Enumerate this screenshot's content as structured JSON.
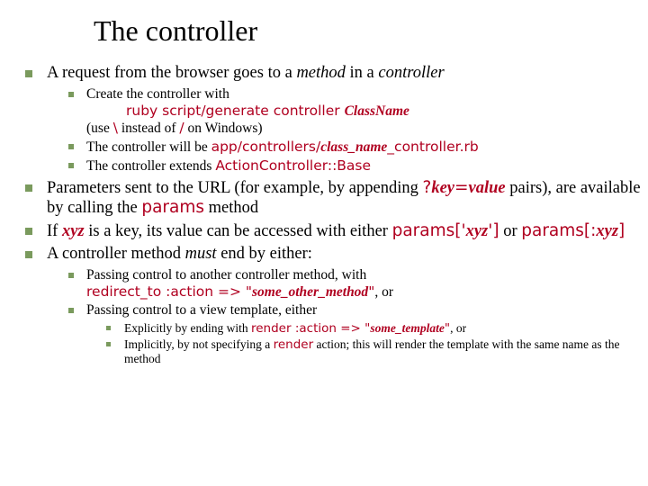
{
  "title": "The controller",
  "b1": {
    "t0a": "A request from the browser goes to a ",
    "t0b": "method",
    "t0c": " in a ",
    "t0d": "controller"
  },
  "b1s": {
    "a0": "Create the controller with",
    "a1": "ruby script/generate controller ",
    "a2": "ClassName",
    "a3": "(use ",
    "a4": "\\",
    "a5": " instead of ",
    "a6": "/",
    "a7": " on Windows)",
    "b0": "The controller will be ",
    "b1": "app/controllers/",
    "b2": "class_name",
    "b3": "_controller.rb",
    "c0": "The controller extends ",
    "c1": "ActionController::Base"
  },
  "b2": {
    "t0": "Parameters sent to the URL (for example, by appending ",
    "t1": "?",
    "t2": "key",
    "t3": "=",
    "t4": "value",
    "t5": " pairs), are available by calling the ",
    "t6": "params",
    "t7": " method"
  },
  "b3": {
    "t0": "If ",
    "t1": "xyz",
    "t2": " is a key, its value can be accessed with either ",
    "t3": "params['",
    "t4": "xyz",
    "t5": "']",
    "t6": " or ",
    "t7": "params[:",
    "t8": "xyz",
    "t9": "]"
  },
  "b4": {
    "t0": "A controller method ",
    "t1": "must",
    "t2": " end by either:"
  },
  "b4s": {
    "a0": "Passing control to another controller method, with",
    "a1": "redirect_to :action => \"",
    "a2": "some_other_method",
    "a3": "\"",
    "a4": ", or",
    "b0": "Passing control to a view template, either"
  },
  "b4ss": {
    "a0": "Explicitly by ending with ",
    "a1": "render :action => \"",
    "a2": "some_template",
    "a3": "\"",
    "a4": ", or",
    "b0": "Implicitly, by not specifying a ",
    "b1": "render",
    "b2": " action; this will render the template with the same name as the method"
  }
}
